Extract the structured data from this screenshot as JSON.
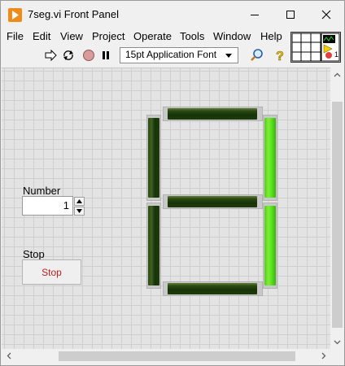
{
  "window": {
    "title": "7seg.vi Front Panel"
  },
  "menu": {
    "items": [
      "File",
      "Edit",
      "View",
      "Project",
      "Operate",
      "Tools",
      "Window",
      "Help"
    ]
  },
  "toolbar": {
    "font_select": "15pt Application Font",
    "icons": [
      "run-arrow-icon",
      "run-continuously-icon",
      "abort-icon",
      "pause-icon",
      "search-icon",
      "help-icon"
    ]
  },
  "connector_pane": {
    "label": "1"
  },
  "controls": {
    "number": {
      "label": "Number",
      "value": "1"
    },
    "stop": {
      "label": "Stop",
      "button_text": "Stop"
    }
  },
  "display": {
    "segments": {
      "top": false,
      "upper_left": false,
      "upper_right": true,
      "middle": false,
      "lower_left": false,
      "lower_right": true,
      "bottom": false
    },
    "colors": {
      "on": "#6ae82a",
      "off": "#1d3b0c"
    }
  }
}
